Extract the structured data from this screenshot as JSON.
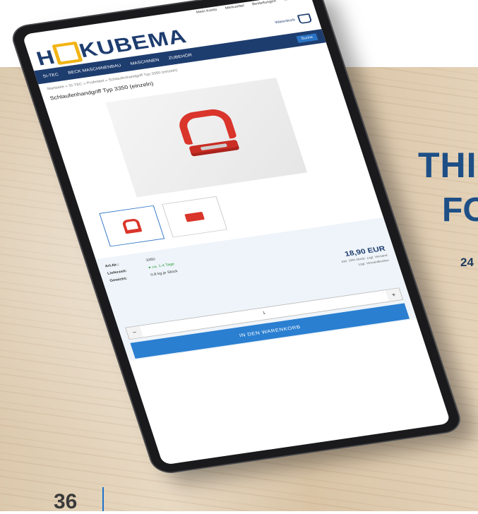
{
  "page": {
    "headline_line1": "THI",
    "headline_line2": "FO",
    "subline": "24",
    "page_number": "36"
  },
  "site": {
    "util_links": [
      "Mein Konto",
      "Merkzettel",
      "Bestellungen",
      "Warenkorb"
    ],
    "logo_text_ho": "H",
    "logo_text_rest": "KUBEMA",
    "cart_label": "Warenkorb",
    "nav": [
      "SI-TEC",
      "BECK MASCHINENBAU",
      "MASCHINEN",
      "ZUBEHÖR"
    ],
    "search_label": "Suche",
    "breadcrumb": "Startseite  »  SI-TEC  »  Prüfmittel  »  Schlaufenhandgriff Typ 3350 (einzeln)",
    "product_title": "Schlaufenhandgriff Typ 3350 (einzeln)"
  },
  "product": {
    "art_label": "Art.Nr.:",
    "art_value": "3350",
    "delivery_label": "Lieferzeit:",
    "delivery_value": "● ca. 1-4 Tage",
    "weight_label": "Gewicht:",
    "weight_value": "0,8 kg je Stück",
    "price": "18,90 EUR",
    "price_note_1": "inkl. 19% MwSt. zzgl. Versand",
    "price_note_2": "zzgl. Versandkosten",
    "qty_minus": "−",
    "qty_value": "1",
    "qty_plus": "+",
    "cart_button": "IN DEN WARENKORB"
  }
}
